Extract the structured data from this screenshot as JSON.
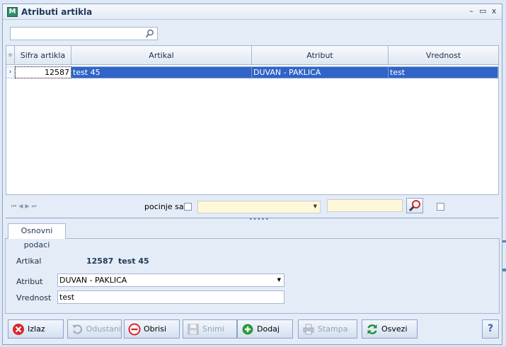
{
  "window": {
    "app_icon": "M",
    "title": "Atributi artikla",
    "controls": {
      "minimize": "–",
      "maximize": "▭",
      "close": "x"
    }
  },
  "search": {
    "value": "",
    "placeholder": "",
    "icon": "search-icon"
  },
  "grid": {
    "header_indicator": "✳",
    "columns": [
      "Sifra artikla",
      "Artikal",
      "Atribut",
      "Vrednost"
    ],
    "rows": [
      {
        "indicator": "›",
        "sifra": "12587",
        "artikal": "test 45",
        "atribut": "DUVAN - PAKLICA",
        "vrednost": "test"
      }
    ]
  },
  "navigator": {
    "arrows": [
      "⏮",
      "◀",
      "▶",
      "⏭"
    ],
    "starts_with_label": "pocinje sa",
    "combo_value": "",
    "search_value": ""
  },
  "details": {
    "tab_label": "Osnovni podaci",
    "artikal_label": "Artikal",
    "artikal_code": "12587",
    "artikal_name": "test 45",
    "atribut_label": "Atribut",
    "atribut_value": "DUVAN - PAKLICA",
    "vrednost_label": "Vrednost",
    "vrednost_value": "test"
  },
  "buttons": {
    "exit": "Izlaz",
    "undo": "Odustani",
    "delete": "Obrisi",
    "save": "Snimi",
    "add": "Dodaj",
    "print": "Stampa",
    "refresh": "Osvezi",
    "help": "?"
  },
  "colors": {
    "selection": "#3064c6",
    "exit_red": "#d9262b",
    "add_green": "#2a9a3a",
    "refresh_green": "#1f8f3c",
    "input_yellow": "#fff8d8"
  }
}
